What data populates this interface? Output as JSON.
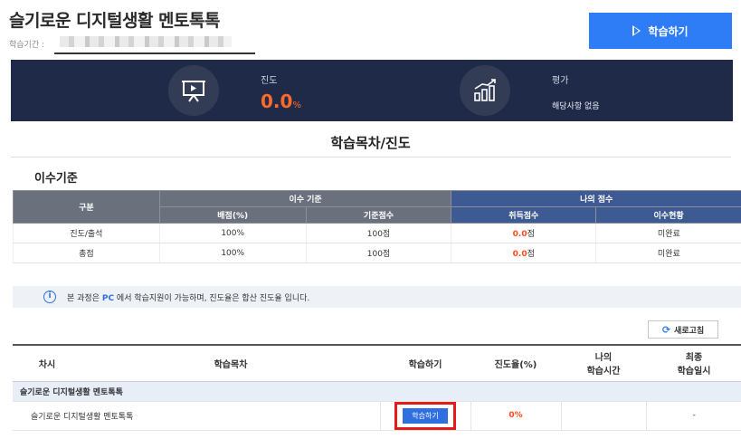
{
  "header": {
    "course_title": "슬기로운 디지털생활 멘토톡톡",
    "period_label": "학습기간 :",
    "study_button": "학습하기"
  },
  "stats": {
    "progress_label": "진도",
    "progress_value": "0.0",
    "progress_unit": "%",
    "eval_label": "평가",
    "eval_value": "해당사항 없음"
  },
  "section": {
    "title": "학습목차/진도",
    "criteria_title": "이수기준"
  },
  "criteria_table": {
    "col_category": "구분",
    "group_standard": "이수 기준",
    "group_mine": "나의 점수",
    "sub_headers": [
      "배점(%)",
      "기준점수",
      "취득점수",
      "이수현황"
    ],
    "rows": [
      {
        "category": "진도/출석",
        "weight": "100%",
        "standard": "100점",
        "score_num": "0.0",
        "score_unit": "점",
        "status": "미완료"
      },
      {
        "category": "총점",
        "weight": "100%",
        "standard": "100점",
        "score_num": "0.0",
        "score_unit": "점",
        "status": "미완료"
      }
    ]
  },
  "notice": {
    "prefix": "본 과정은 ",
    "pc": "PC",
    "suffix": " 에서 학습지원이 가능하며, 진도율은 합산 진도율 입니다."
  },
  "refresh_button": "새로고침",
  "lesson_table": {
    "headers": [
      "차시",
      "학습목차",
      "학습하기",
      "진도율(%)",
      "나의\n학습시간",
      "최종\n학습일시"
    ],
    "group_row": "슬기로운 디지털생활 멘토톡톡",
    "lesson": {
      "name": "슬기로운 디지털생활 멘토톡톡",
      "start_button": "학습하기",
      "progress": "0%",
      "time": "",
      "last_date": "-"
    }
  },
  "colors": {
    "accent_blue": "#2f7df6",
    "band_navy": "#1f2a48",
    "highlight_orange": "#ff6a2b",
    "annotation_red": "#e51b1b"
  }
}
